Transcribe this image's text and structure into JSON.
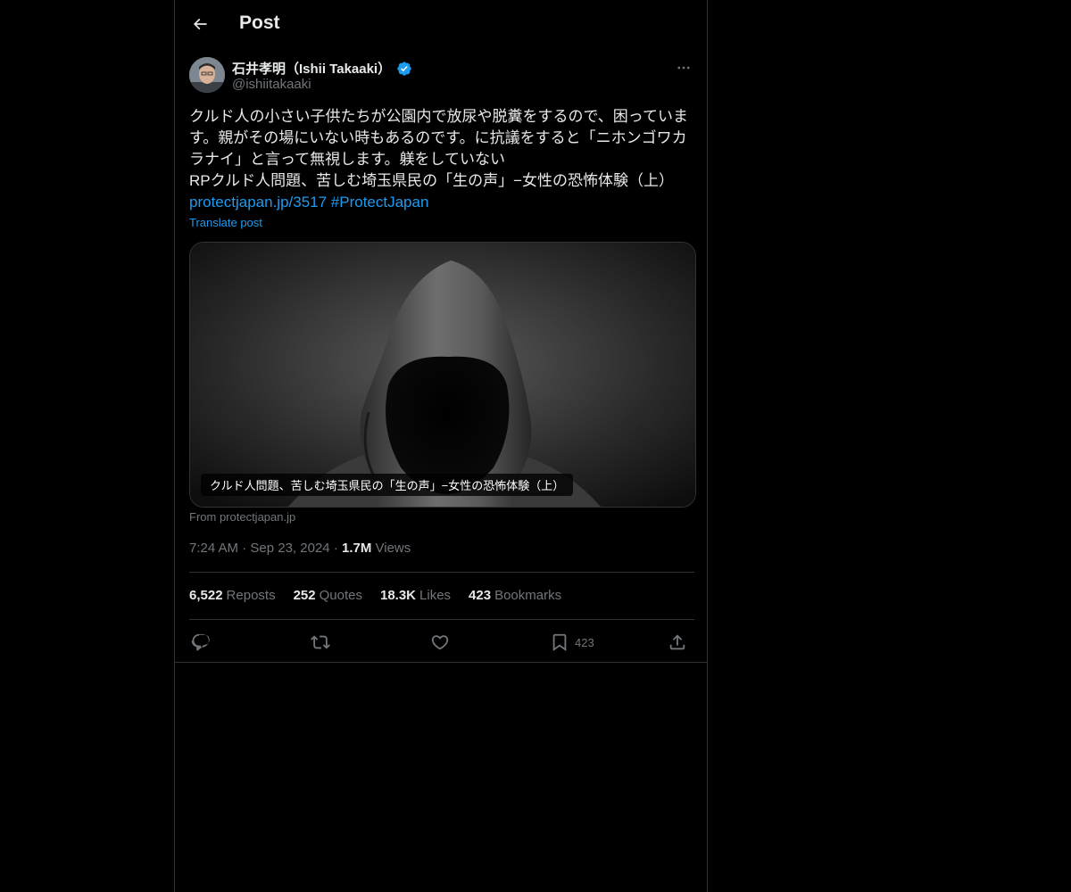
{
  "header": {
    "title": "Post"
  },
  "author": {
    "name": "石井孝明（Ishii Takaaki）",
    "handle": "@ishiitakaaki"
  },
  "post": {
    "lines": [
      "クルド人の小さい子供たちが公園内で放尿や脱糞をするので、困っていま",
      "す。親がその場にいない時もあるのです。に抗議をすると「ニホンゴワカ",
      "ラナイ」と言って無視します。躾をしていない",
      "RPクルド人問題、苦しむ埼玉県民の「生の声」−女性の恐怖体験（上）"
    ],
    "link": "protectjapan.jp/3517",
    "hashtag": "#ProtectJapan",
    "translate": "Translate post"
  },
  "card": {
    "caption": "クルド人問題、苦しむ埼玉県民の「生の声」−女性の恐怖体験（上）",
    "from": "From protectjapan.jp"
  },
  "meta": {
    "time": "7:24 AM",
    "date": "Sep 23, 2024",
    "views_count": "1.7M",
    "views_label": "Views"
  },
  "stats": {
    "reposts_count": "6,522",
    "reposts_label": "Reposts",
    "quotes_count": "252",
    "quotes_label": "Quotes",
    "likes_count": "18.3K",
    "likes_label": "Likes",
    "bookmarks_count": "423",
    "bookmarks_label": "Bookmarks"
  },
  "actions": {
    "reply_icon": "reply-icon",
    "repost_icon": "repost-icon",
    "like_icon": "heart-icon",
    "bookmark_icon": "bookmark-icon",
    "bookmark_count": "423",
    "share_icon": "share-icon"
  },
  "colors": {
    "background": "#000000",
    "accent": "#1d9bf0",
    "text": "#e7e9ea",
    "muted": "#71767b",
    "border": "#2f3336"
  }
}
